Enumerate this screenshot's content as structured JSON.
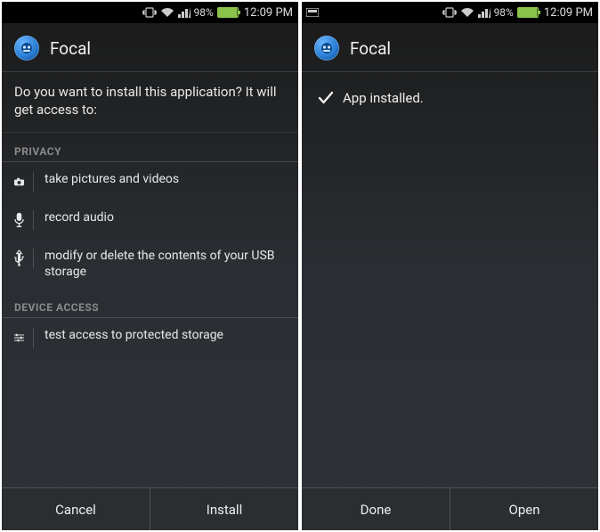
{
  "statusbar": {
    "battery_pct": "98%",
    "time": "12:09 PM"
  },
  "app": {
    "title": "Focal"
  },
  "left": {
    "prompt": "Do you want to install this application? It will get access to:",
    "sections": {
      "privacy_label": "PRIVACY",
      "device_label": "DEVICE ACCESS"
    },
    "perms": {
      "camera": "take pictures and videos",
      "mic": "record audio",
      "usb": "modify or delete the contents of your USB storage",
      "storage": "test access to protected storage"
    },
    "buttons": {
      "cancel": "Cancel",
      "install": "Install"
    }
  },
  "right": {
    "installed_text": "App installed.",
    "buttons": {
      "done": "Done",
      "open": "Open"
    }
  }
}
